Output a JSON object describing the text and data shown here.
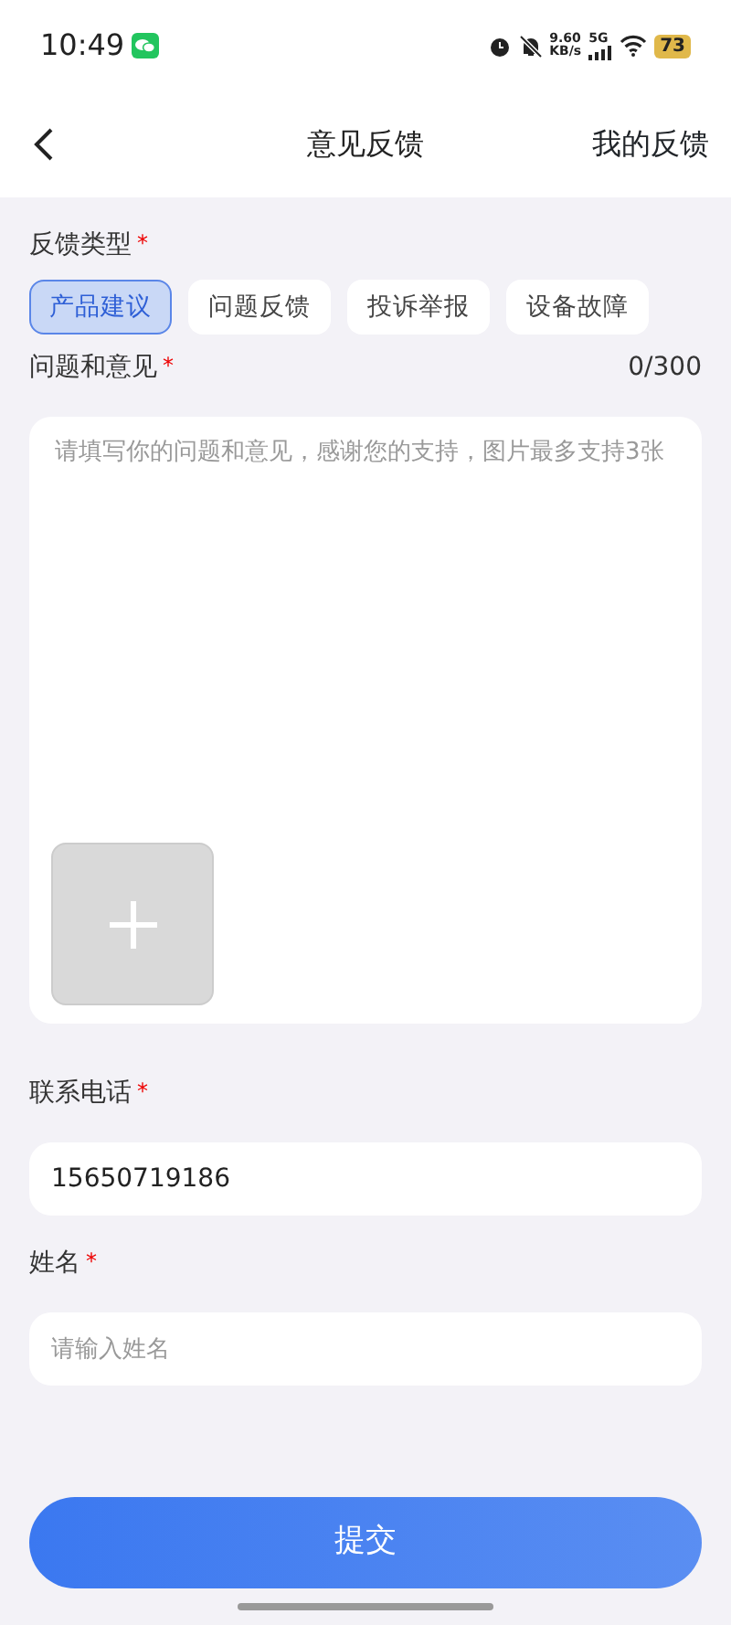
{
  "status_bar": {
    "time": "10:49",
    "speed": "9.60",
    "speed_unit": "KB/s",
    "network": "5G",
    "battery": "73"
  },
  "header": {
    "title": "意见反馈",
    "action": "我的反馈"
  },
  "type_label": {
    "text": "反馈类型",
    "mark": "*"
  },
  "types": [
    {
      "label": "产品建议",
      "selected": true
    },
    {
      "label": "问题反馈",
      "selected": false
    },
    {
      "label": "投诉举报",
      "selected": false
    },
    {
      "label": "设备故障",
      "selected": false
    }
  ],
  "content_label": {
    "text": "问题和意见",
    "mark": "*"
  },
  "counter": "0/300",
  "content": {
    "placeholder": "请填写你的问题和意见，感谢您的支持，图片最多支持3张"
  },
  "phone_label": {
    "text": "联系电话",
    "mark": "*"
  },
  "phone": {
    "value": "15650719186"
  },
  "name_label": {
    "text": "姓名",
    "mark": "*"
  },
  "name_field": {
    "placeholder": "请输入姓名"
  },
  "submit": "提交"
}
